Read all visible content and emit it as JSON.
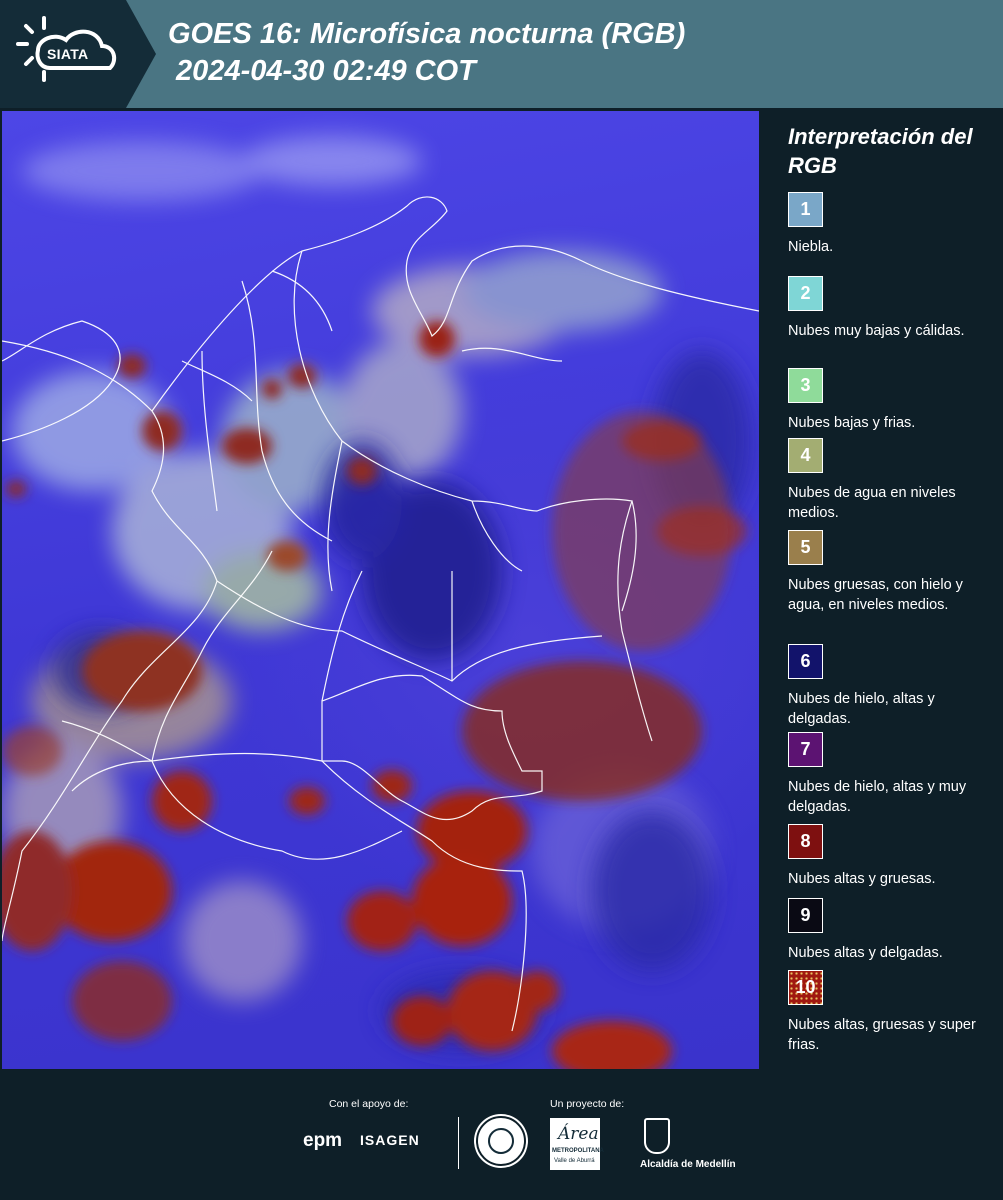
{
  "header": {
    "logo_text": "SIATA",
    "title": "GOES 16: Microfísica nocturna (RGB)\n 2024-04-30 02:49 COT"
  },
  "map": {
    "description_icon": "satellite-rgb-map",
    "background_color": "#4038d8",
    "cloud_colors": {
      "thick_high": "#9b2410",
      "low_warm": "#9fc0d6",
      "mid_water": "#a9b98c",
      "thin_high": "#1e1a7a"
    }
  },
  "legend": {
    "title": "Interpretación del RGB",
    "items": [
      {
        "number": "1",
        "label": "Niebla.",
        "color": "#7aa7c8"
      },
      {
        "number": "2",
        "label": "Nubes muy bajas y cálidas.",
        "color": "#7fd6d6"
      },
      {
        "number": "3",
        "label": "Nubes bajas y frias.",
        "color": "#8fdb9a"
      },
      {
        "number": "4",
        "label": "Nubes de agua en niveles medios.",
        "color": "#a3ad72"
      },
      {
        "number": "5",
        "label": "Nubes gruesas, con hielo y agua, en niveles medios.",
        "color": "#9a7f4c"
      },
      {
        "number": "6",
        "label": "Nubes de hielo, altas y delgadas.",
        "color": "#12136b"
      },
      {
        "number": "7",
        "label": "Nubes de hielo, altas y muy delgadas.",
        "color": "#5c1372"
      },
      {
        "number": "8",
        "label": "Nubes altas y gruesas.",
        "color": "#7e1010"
      },
      {
        "number": "9",
        "label": "Nubes altas y delgadas.",
        "color": "#0a0a14"
      },
      {
        "number": "10",
        "label": "Nubes altas, gruesas y super frias.",
        "color": "#a01810"
      }
    ]
  },
  "footer": {
    "support_label": "Con el apoyo de:",
    "project_label": "Un proyecto de:",
    "epm": "epm",
    "isagen": "ISAGEN",
    "area_word": "Área",
    "area_sub1": "METROPOLITANA",
    "area_sub2": "Valle de Aburrá",
    "medellin": "Alcaldía de Medellín"
  }
}
